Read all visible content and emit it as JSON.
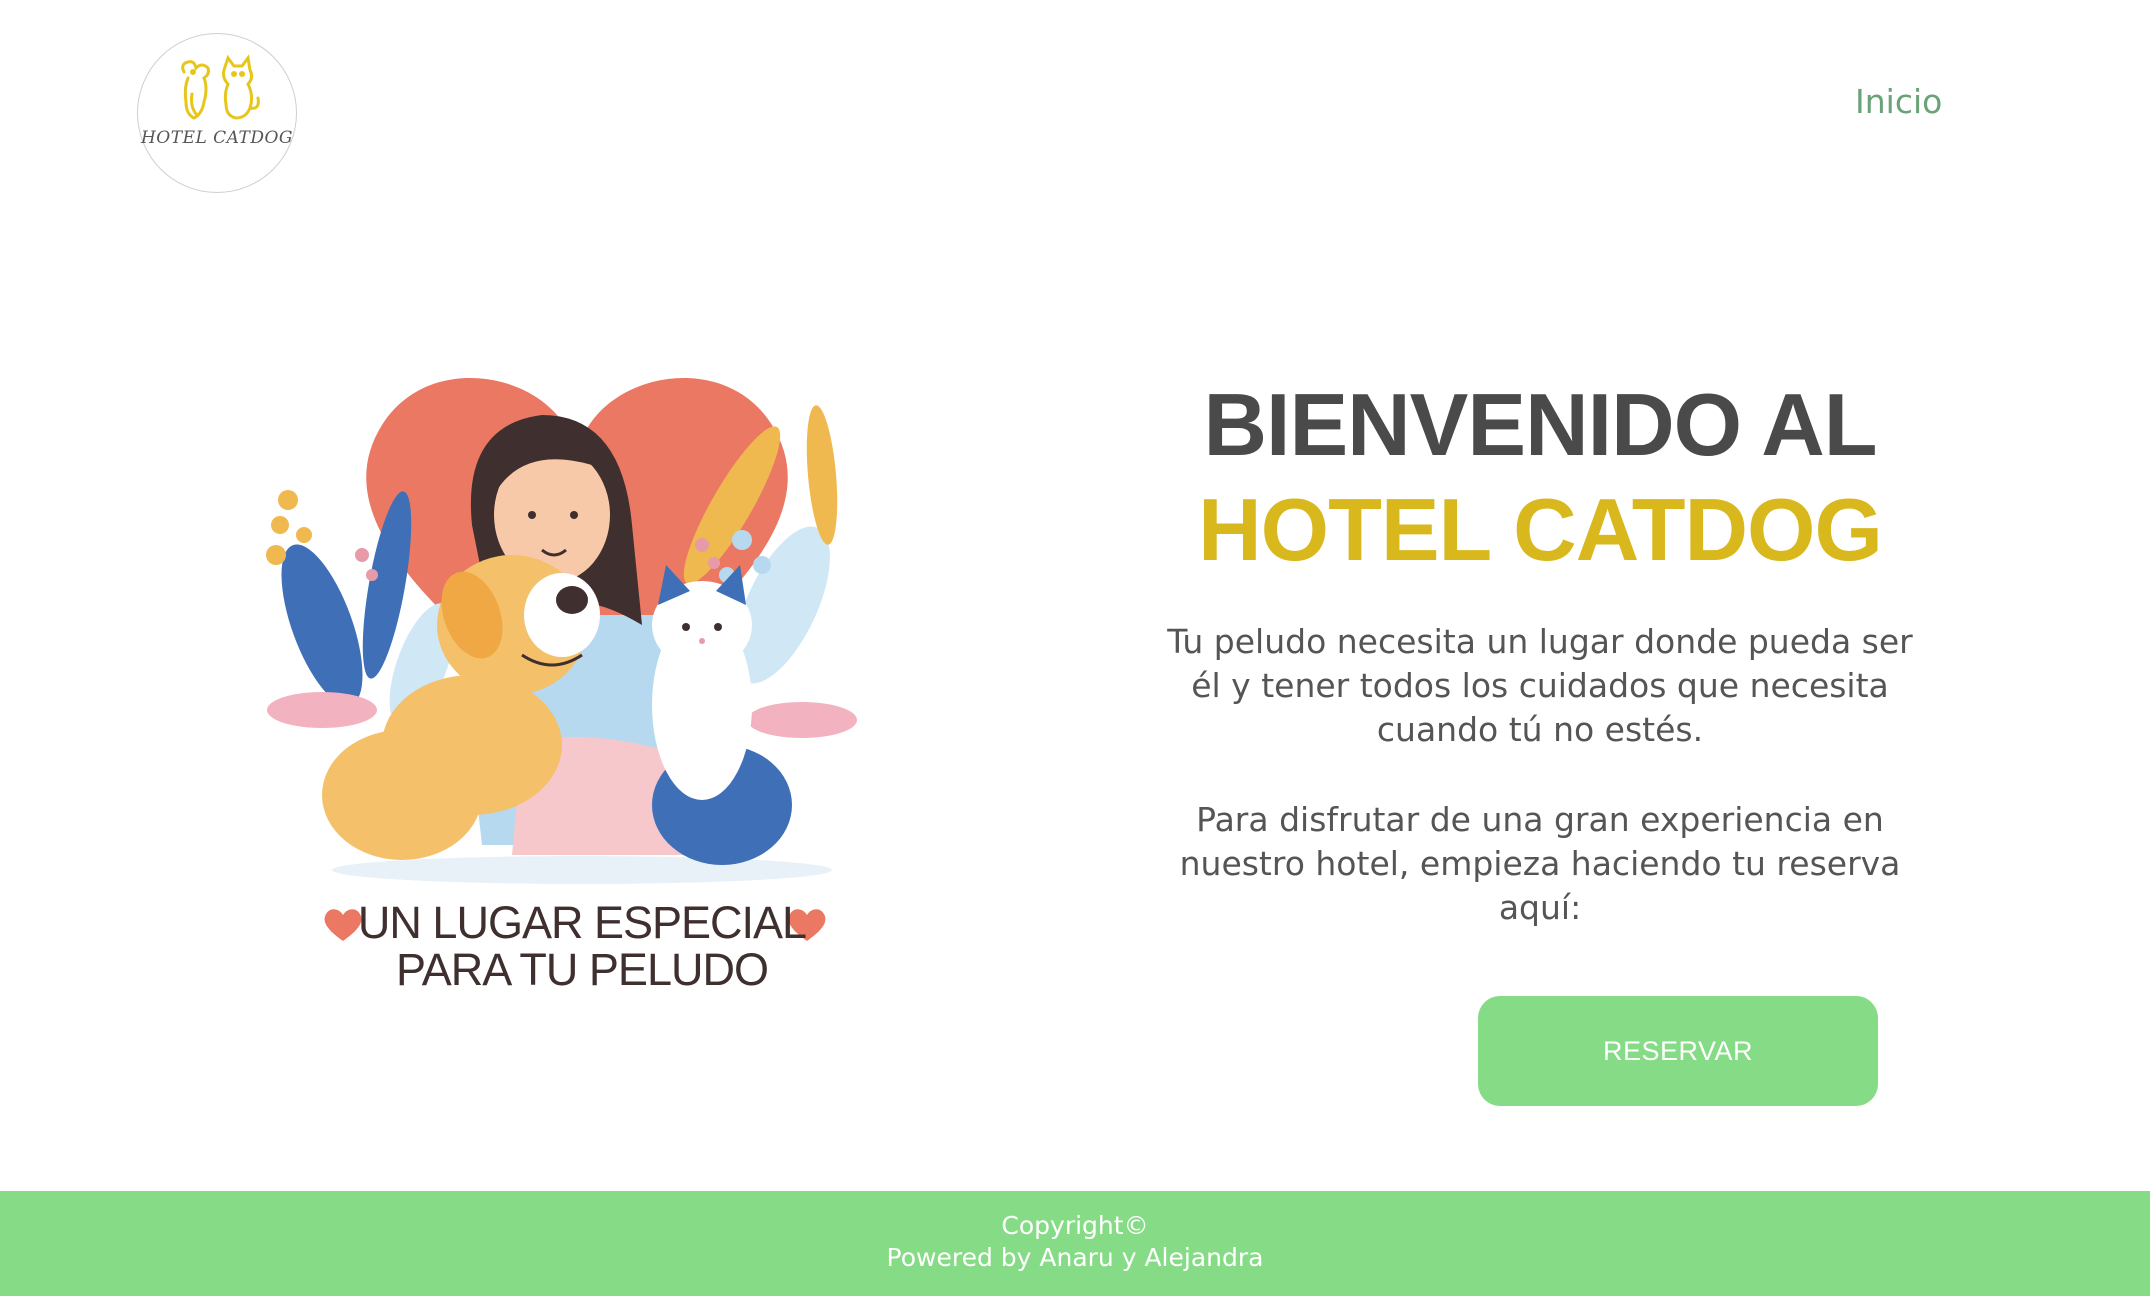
{
  "header": {
    "logo_text": "HOTEL CATDOG",
    "nav": {
      "home_label": "Inicio"
    }
  },
  "hero": {
    "caption_line1": "UN LUGAR ESPECIAL",
    "caption_line2": "PARA TU PELUDO"
  },
  "main": {
    "heading_line1": "BIENVENIDO AL",
    "heading_line2": "HOTEL CATDOG",
    "paragraph1": "Tu peludo necesita un lugar donde pueda ser él y tener todos los cuidados que necesita cuando tú no estés.",
    "paragraph2": "Para disfrutar de una gran experiencia en nuestro hotel, empieza haciendo tu reserva aquí:",
    "reserve_button": "RESERVAR"
  },
  "footer": {
    "copyright": "Copyright©",
    "powered_by": "Powered by Anaru y Alejandra"
  },
  "colors": {
    "accent_green": "#86dc86",
    "brand_yellow": "#d8b81d",
    "nav_green": "#6aa37a",
    "heading_gray": "#4a4a4a"
  },
  "icons": [
    "hotel-logo-icon",
    "heart-icon"
  ]
}
